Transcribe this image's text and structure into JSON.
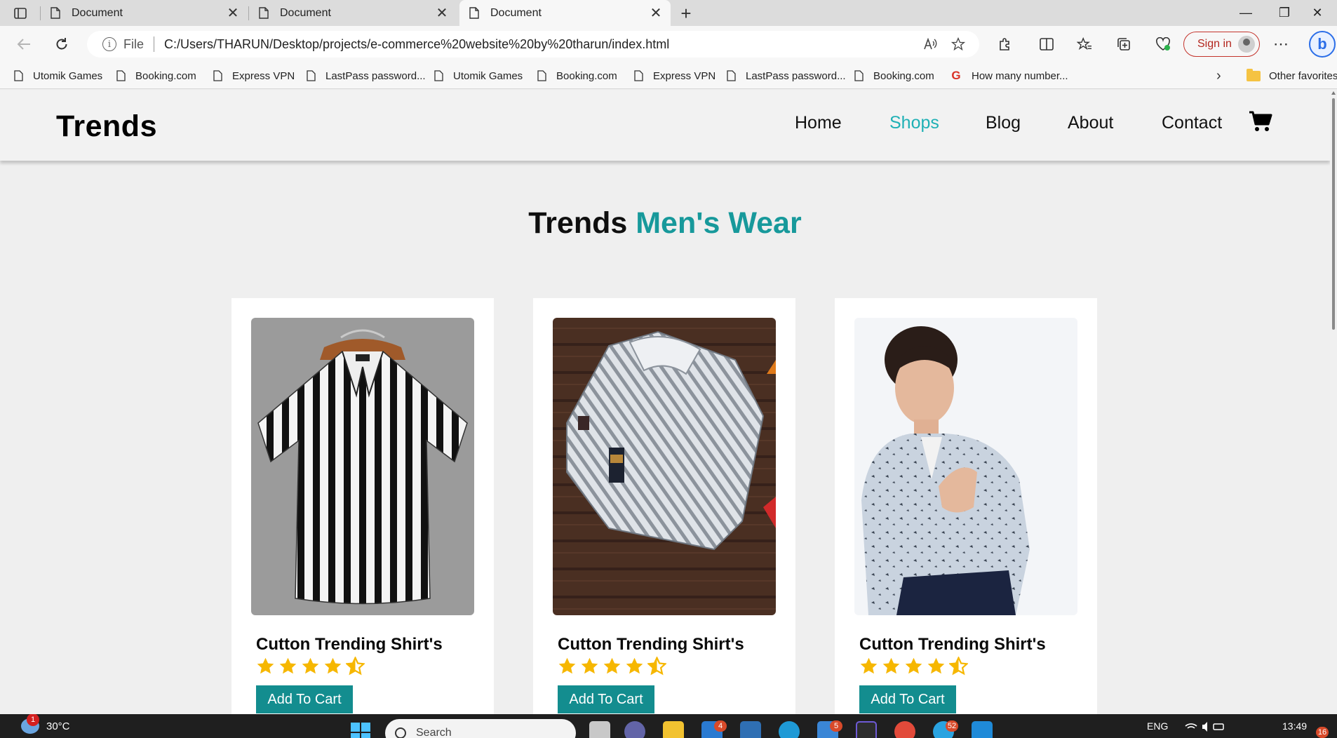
{
  "browser": {
    "tabs": [
      {
        "title": "Document",
        "active": false
      },
      {
        "title": "Document",
        "active": false
      },
      {
        "title": "Document",
        "active": true
      }
    ],
    "new_tab_symbol": "+",
    "close_symbol": "✕",
    "window_controls": {
      "minimize": "—",
      "restore": "❐",
      "close": "✕"
    },
    "address": {
      "info_symbol": "i",
      "scheme_label": "File",
      "url": "C:/Users/THARUN/Desktop/projects/e-commerce%20website%20by%20tharun/index.html"
    },
    "sign_in_label": "Sign in",
    "favorites": [
      {
        "label": "Utomik Games",
        "icon": "page-icon"
      },
      {
        "label": "Booking.com",
        "icon": "page-icon"
      },
      {
        "label": "Express VPN",
        "icon": "page-icon"
      },
      {
        "label": "LastPass password...",
        "icon": "page-icon"
      },
      {
        "label": "Utomik Games",
        "icon": "page-icon"
      },
      {
        "label": "Booking.com",
        "icon": "page-icon"
      },
      {
        "label": "Express VPN",
        "icon": "page-icon"
      },
      {
        "label": "LastPass password...",
        "icon": "page-icon"
      },
      {
        "label": "Booking.com",
        "icon": "page-icon"
      },
      {
        "label": "How many number...",
        "icon": "google-icon"
      }
    ],
    "other_favorites_label": "Other favorites"
  },
  "site": {
    "logo": "Trends",
    "nav": [
      {
        "label": "Home",
        "active": false
      },
      {
        "label": "Shops",
        "active": true
      },
      {
        "label": "Blog",
        "active": false
      },
      {
        "label": "About",
        "active": false
      },
      {
        "label": "Contact",
        "active": false
      }
    ],
    "accent_color": "#1fb0b5",
    "button_color": "#138d8f"
  },
  "headline": {
    "main": "Trends",
    "accent": "Men's Wear"
  },
  "products": [
    {
      "name": "Cutton Trending Shirt's",
      "rating": 4.5,
      "button_label": "Add To Cart",
      "image": "black-white-striped-shirt"
    },
    {
      "name": "Cutton Trending Shirt's",
      "rating": 4.5,
      "button_label": "Add To Cart",
      "image": "grey-striped-folded-shirt"
    },
    {
      "name": "Cutton Trending Shirt's",
      "rating": 4.5,
      "button_label": "Add To Cart",
      "image": "man-in-printed-shirt"
    }
  ],
  "taskbar": {
    "weather_temp": "30°C",
    "weather_badge": "1",
    "search_placeholder": "Search",
    "badges": [
      "4",
      "5",
      "52"
    ],
    "language": "ENG",
    "time": "13:49",
    "notification_count": "16"
  }
}
